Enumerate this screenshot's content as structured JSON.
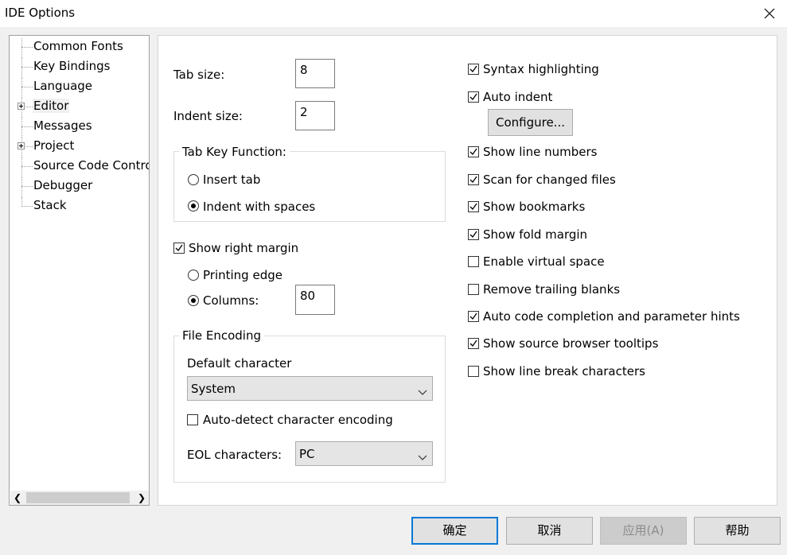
{
  "window": {
    "title": "IDE Options"
  },
  "tree": {
    "items": [
      {
        "label": "Common Fonts",
        "expandable": false
      },
      {
        "label": "Key Bindings",
        "expandable": false
      },
      {
        "label": "Language",
        "expandable": false
      },
      {
        "label": "Editor",
        "expandable": true,
        "selected": true
      },
      {
        "label": "Messages",
        "expandable": false
      },
      {
        "label": "Project",
        "expandable": true
      },
      {
        "label": "Source Code Contro",
        "expandable": false
      },
      {
        "label": "Debugger",
        "expandable": false
      },
      {
        "label": "Stack",
        "expandable": false
      }
    ]
  },
  "editor": {
    "tab_size_label": "Tab size:",
    "tab_size_value": "8",
    "indent_size_label": "Indent size:",
    "indent_size_value": "2",
    "tab_key_group_title": "Tab Key Function:",
    "insert_tab_label": "Insert tab",
    "indent_spaces_label": "Indent with spaces",
    "show_right_margin_label": "Show right margin",
    "printing_edge_label": "Printing edge",
    "columns_label": "Columns:",
    "columns_value": "80",
    "file_encoding_group_title": "File Encoding",
    "default_character_label": "Default character",
    "default_character_value": "System",
    "auto_detect_label": "Auto-detect character encoding",
    "eol_label": "EOL characters:",
    "eol_value": "PC",
    "syntax_highlighting_label": "Syntax highlighting",
    "auto_indent_label": "Auto indent",
    "configure_label": "Configure...",
    "show_line_numbers_label": "Show line numbers",
    "scan_changed_label": "Scan for changed files",
    "show_bookmarks_label": "Show bookmarks",
    "show_fold_margin_label": "Show fold margin",
    "enable_virtual_space_label": "Enable virtual space",
    "remove_trailing_label": "Remove trailing blanks",
    "auto_code_completion_label": "Auto code completion and parameter hints",
    "show_source_browser_label": "Show source browser tooltips",
    "show_line_break_label": "Show line break characters"
  },
  "buttons": {
    "ok": "确定",
    "cancel": "取消",
    "apply": "应用(A)",
    "help": "帮助"
  },
  "colors": {
    "default_button_border": "#0078d7"
  }
}
